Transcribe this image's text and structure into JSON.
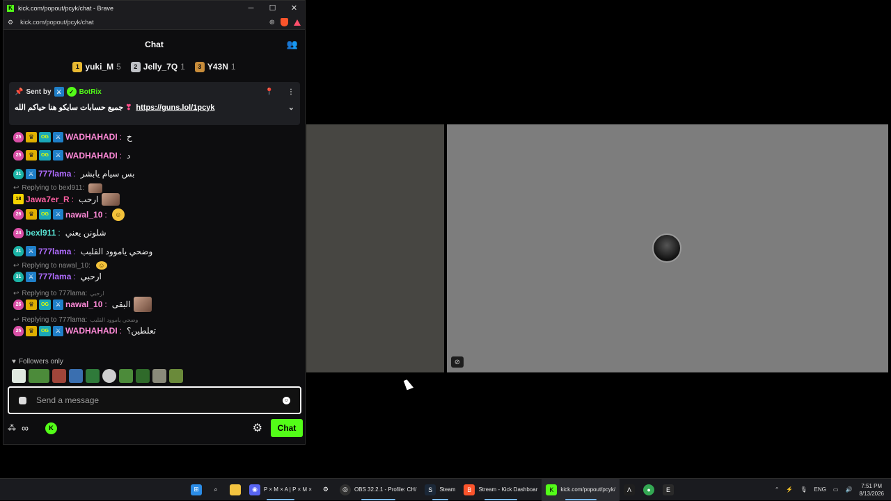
{
  "browser": {
    "title": "kick.com/popout/pcyk/chat - Brave",
    "url": "kick.com/popout/pcyk/chat",
    "controls": {
      "minimize": "─",
      "maximize": "☐",
      "close": "✕"
    }
  },
  "chat": {
    "header": "Chat",
    "leaderboard": [
      {
        "rank": "1",
        "name": "yuki_M",
        "count": "5"
      },
      {
        "rank": "2",
        "name": "Jelly_7Q",
        "count": "1"
      },
      {
        "rank": "3",
        "name": "Y43N",
        "count": "1"
      }
    ],
    "pinned": {
      "sent_by": "Sent by",
      "sender": "BotRix",
      "text": "جميع حسابات سايكو هنا حياكم الله",
      "link": "https://guns.lol/1pcyk"
    },
    "messages": [
      {
        "sub": "25",
        "name": "WADHAHADI",
        "text": "خ"
      },
      {
        "sub": "25",
        "name": "WADHAHADI",
        "text": "د"
      },
      {
        "sub": "31",
        "name": "777lama",
        "text": "بس سيام يابشر"
      },
      {
        "reply": "Replying to bexl911:",
        "sub": "18",
        "name": "Jawa7er_R",
        "text": "ارحب"
      },
      {
        "sub": "26",
        "name": "nawal_10",
        "text": ""
      },
      {
        "sub": "24",
        "name": "bexl911",
        "text": "شلونن يعني"
      },
      {
        "sub": "31",
        "name": "777lama",
        "text": "وضحي ياموود القلبب"
      },
      {
        "reply": "Replying to nawal_10:",
        "sub": "31",
        "name": "777lama",
        "text": "ارحبي"
      },
      {
        "reply": "Replying to 777lama:",
        "reply_text": "ارحبي",
        "sub": "26",
        "name": "nawal_10",
        "text": "البقى"
      },
      {
        "reply": "Replying to 777lama:",
        "reply_text": "وضحي ياموود القلبب",
        "sub": "25",
        "name": "WADHAHADI",
        "text": "تعلطين؟"
      }
    ],
    "followers_only": "Followers only",
    "input_placeholder": "Send a message",
    "chat_button": "Chat",
    "infinity": "∞"
  },
  "taskbar": {
    "items": [
      {
        "label": "",
        "icon": "windows-icon"
      },
      {
        "label": "",
        "icon": "search-icon"
      },
      {
        "label": "",
        "icon": "folder-icon"
      },
      {
        "label": "P × M × A | P × M ×",
        "icon": "discord-icon"
      },
      {
        "label": "",
        "icon": "settings-icon"
      },
      {
        "label": "OBS 32.2.1 - Profile: CH/",
        "icon": "obs-icon"
      },
      {
        "label": "Steam",
        "icon": "steam-icon"
      },
      {
        "label": "Stream - Kick Dashboar",
        "icon": "brave-icon"
      },
      {
        "label": "kick.com/popout/pcyk/",
        "icon": "kick-icon"
      },
      {
        "label": "",
        "icon": "app-icon"
      },
      {
        "label": "",
        "icon": "chrome-icon"
      },
      {
        "label": "",
        "icon": "epic-icon"
      }
    ],
    "lang": "ENG",
    "time": "7:51 PM",
    "date": "8/13/2026"
  }
}
